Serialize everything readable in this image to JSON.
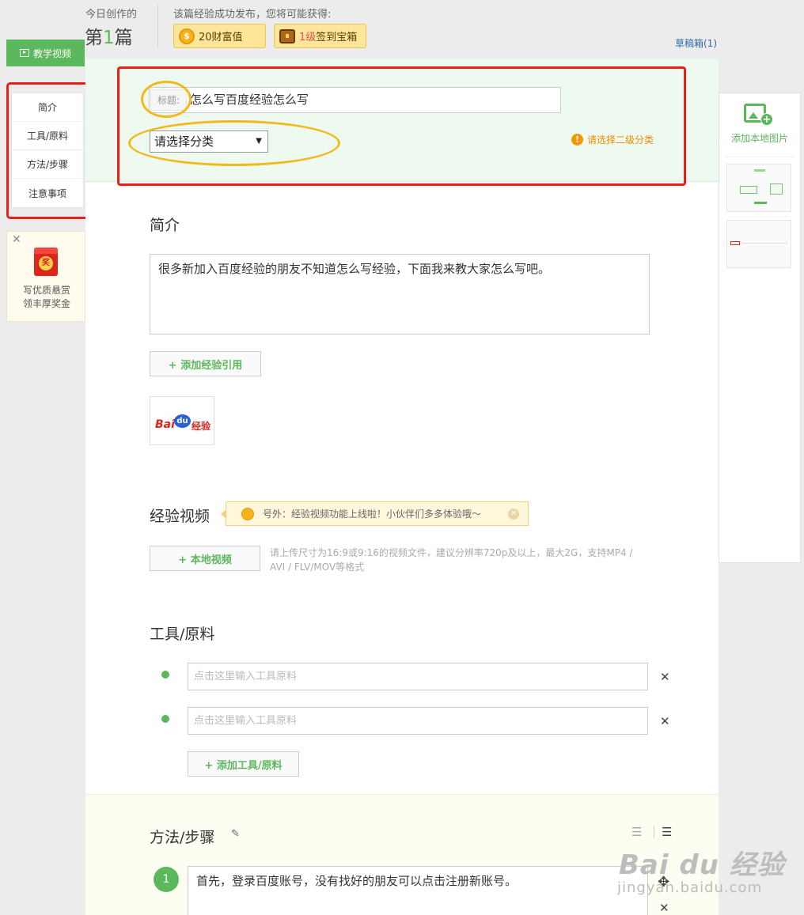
{
  "header": {
    "today_label": "今日创作的",
    "today_prefix": "第",
    "today_number": "1",
    "today_suffix": "篇",
    "reward_label": "该篇经验成功发布，您将可能获得:",
    "reward_wealth": "20财富值",
    "reward_chest_level": "1级",
    "reward_chest_text": "签到宝箱",
    "drafts": "草稿箱(1)"
  },
  "sidebar": {
    "video_button": "教学视频",
    "items": [
      {
        "label": "简介"
      },
      {
        "label": "工具/原料"
      },
      {
        "label": "方法/步骤"
      },
      {
        "label": "注意事项"
      }
    ],
    "promo_badge": "奖",
    "promo_line1": "写优质悬赏",
    "promo_line2": "领丰厚奖金"
  },
  "title_section": {
    "label": "标题:",
    "value": "怎么写百度经验怎么写",
    "category_placeholder": "请选择分类",
    "category_warning": "请选择二级分类"
  },
  "intro": {
    "heading": "简介",
    "text": "很多新加入百度经验的朋友不知道怎么写经验，下面我来教大家怎么写吧。",
    "add_ref_button": "+ 添加经验引用",
    "image_logo_bai": "Bai",
    "image_logo_du": "du",
    "image_logo_jy": "经验"
  },
  "video": {
    "heading": "经验视频",
    "tip": "号外：经验视频功能上线啦！小伙伴们多多体验哦～",
    "local_button": "+ 本地视频",
    "hint": "请上传尺寸为16:9或9:16的视频文件，建议分辨率720p及以上，最大2G，支持MP4 / AVI / FLV/MOV等格式"
  },
  "tools": {
    "heading": "工具/原料",
    "items": [
      {
        "placeholder": "点击这里输入工具原料"
      },
      {
        "placeholder": "点击这里输入工具原料"
      }
    ],
    "add_button": "+ 添加工具/原料"
  },
  "steps": {
    "heading": "方法/步骤",
    "items": [
      {
        "number": "1",
        "text": "首先，登录百度账号，没有找好的朋友可以点击注册新账号。"
      }
    ]
  },
  "right_panel": {
    "add_image_label": "添加本地图片"
  },
  "watermark": {
    "text": "Bai du 经验",
    "url": "jingyan.baidu.com"
  },
  "colors": {
    "accent_green": "#5cb85c",
    "annotation_red": "#e8201a",
    "annotation_yellow": "#f2b91f",
    "warning_orange": "#f39800"
  }
}
